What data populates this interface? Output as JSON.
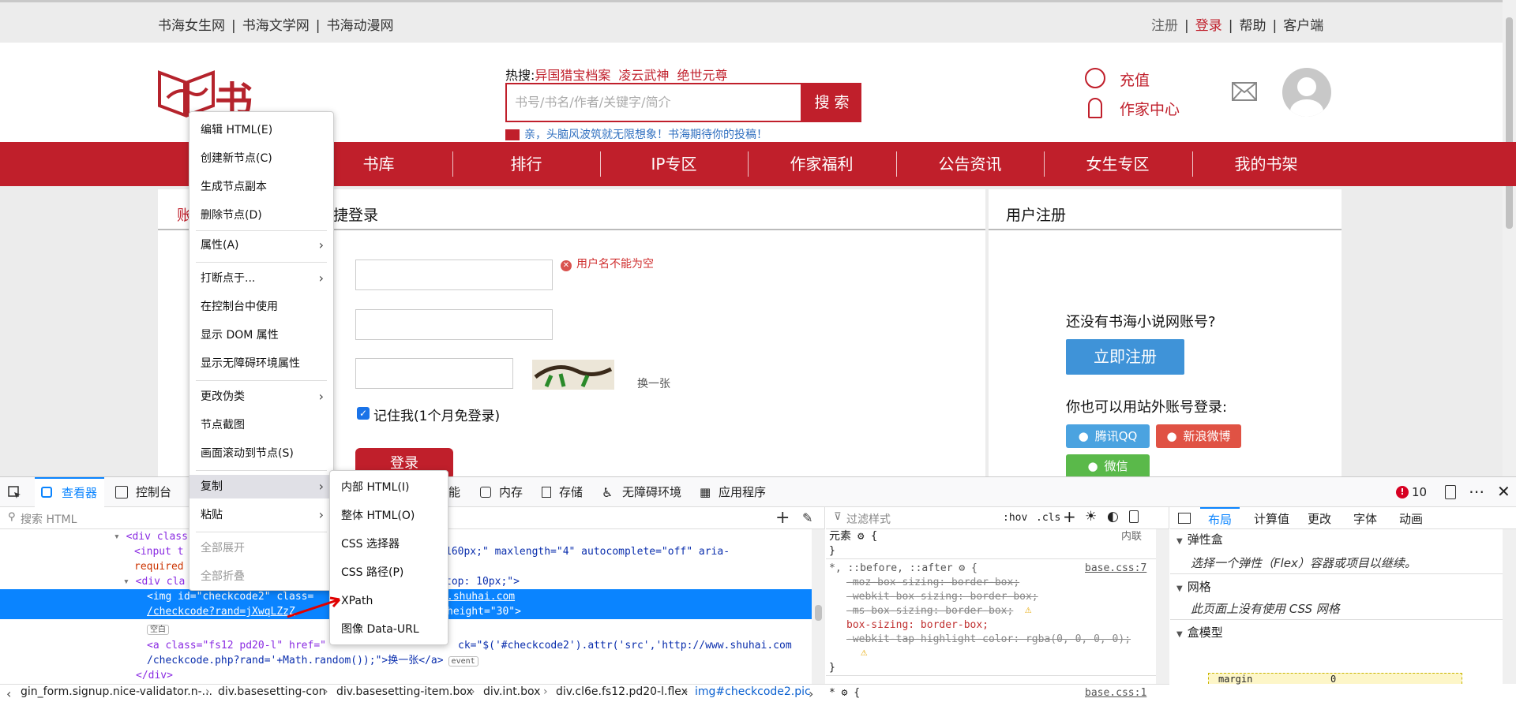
{
  "site": {
    "top_links_left": [
      "书海女生网",
      "书海文学网",
      "书海动漫网"
    ],
    "top_links_right": [
      "注册",
      "登录",
      "帮助",
      "客户端"
    ],
    "logo_text": "书海",
    "hot_search_label": "热搜:",
    "hot_search_terms": [
      "异国猎宝档案",
      "凌云武神",
      "绝世元尊"
    ],
    "search_placeholder": "书号/书名/作者/关键字/简介",
    "search_button": "搜 索",
    "notice": "亲，头脑风波筑就无限想象！书海期待你的投稿！",
    "recharge": "充值",
    "author_center": "作家中心",
    "nav": [
      "书库",
      "排行",
      "IP专区",
      "作家福利",
      "公告资讯",
      "女生专区",
      "我的书架"
    ],
    "login_tab_partial": "账",
    "login_title_partial": "捷登录",
    "register_title": "用户注册",
    "error_username": "用户名不能为空",
    "change_captcha": "换一张",
    "remember_me": "记住我(1个月免登录)",
    "login_button": "登录",
    "no_account": "还没有书海小说网账号?",
    "register_now": "立即注册",
    "external_login": "你也可以用站外账号登录:",
    "social": [
      "腾讯QQ",
      "新浪微博",
      "微信"
    ]
  },
  "context_menu": {
    "items": [
      {
        "label": "编辑 HTML(E)"
      },
      {
        "label": "创建新节点(C)"
      },
      {
        "label": "生成节点副本"
      },
      {
        "label": "删除节点(D)"
      },
      {
        "label": "属性(A)",
        "submenu": true
      },
      {
        "label": "打断点于...",
        "submenu": true
      },
      {
        "label": "在控制台中使用"
      },
      {
        "label": "显示 DOM 属性"
      },
      {
        "label": "显示无障碍环境属性"
      },
      {
        "label": "更改伪类",
        "submenu": true
      },
      {
        "label": "节点截图"
      },
      {
        "label": "画面滚动到节点(S)"
      },
      {
        "label": "复制",
        "submenu": true
      },
      {
        "label": "粘贴",
        "submenu": true
      },
      {
        "label": "全部展开",
        "disabled": true
      },
      {
        "label": "全部折叠",
        "disabled": true
      }
    ],
    "copy_submenu": [
      "内部 HTML(I)",
      "整体 HTML(O)",
      "CSS 选择器",
      "CSS 路径(P)",
      "XPath",
      "图像 Data-URL"
    ]
  },
  "devtools": {
    "tabs": [
      "查看器",
      "控制台",
      "能",
      "内存",
      "存储",
      "无障碍环境",
      "应用程序"
    ],
    "error_count": "10",
    "search_html_placeholder": "搜索 HTML",
    "filter_styles_placeholder": "过滤样式",
    "hov": ":hov",
    "cls": ".cls",
    "right_tabs": [
      "布局",
      "计算值",
      "更改",
      "字体",
      "动画"
    ],
    "html_lines": [
      {
        "pre": "<div class",
        "rest": ""
      },
      {
        "pre": "<input t",
        "rest": "160px;\" maxlength=\"4\" autocomplete=\"off\" aria-"
      },
      {
        "pre": "required",
        "rest": ""
      },
      {
        "pre": "<div cla",
        "rest": "top: 10px;\">"
      },
      {
        "pre": "<img id=\"checkcode2\" class=",
        "rest": ".shuhai.com"
      },
      {
        "pre": "/checkcode?rand=jXwqLZzZ",
        "rest": "height=\"30\">"
      },
      {
        "pre": "空白",
        "rest": ""
      },
      {
        "pre": "<a class=\"fs12 pd20-l\" href=\"",
        "rest": "ck=\"$('#checkcode2').attr('src','http://www.shuhai.com"
      },
      {
        "pre": "/checkcode.php?rand='+Math.random());\">换一张</a>",
        "rest": "event"
      },
      {
        "pre": "</div>",
        "rest": ""
      }
    ],
    "rules": {
      "element_label": "元素",
      "inline_label": "内联",
      "selector": "*, ::before, ::after",
      "source": "base.css:7",
      "props": [
        {
          "text": "-moz-box-sizing: border-box;",
          "struck": true
        },
        {
          "text": "-webkit-box-sizing: border-box;",
          "struck": true
        },
        {
          "text": "-ms-box-sizing: border-box;",
          "struck": true
        },
        {
          "text": "box-sizing: border-box;",
          "struck": false
        },
        {
          "text": "-webkit-tap-highlight-color: rgba(0, 0, 0, 0);",
          "struck": true
        }
      ],
      "next_selector": "*",
      "next_source": "base.css:1"
    },
    "layout": {
      "flexbox_title": "弹性盒",
      "flexbox_text": "选择一个弹性（Flex）容器或项目以继续。",
      "grid_title": "网格",
      "grid_text": "此页面上没有使用 CSS 网格",
      "boxmodel_title": "盒模型",
      "margin_label": "margin",
      "margin_value": "0"
    },
    "breadcrumbs": [
      "gin_form.signup.nice-validator.n-...",
      "div.basesetting-con",
      "div.basesetting-item.box",
      "div.int.box",
      "div.cl6e.fs12.pd20-l.flex",
      "img#checkcode2.pic"
    ]
  }
}
